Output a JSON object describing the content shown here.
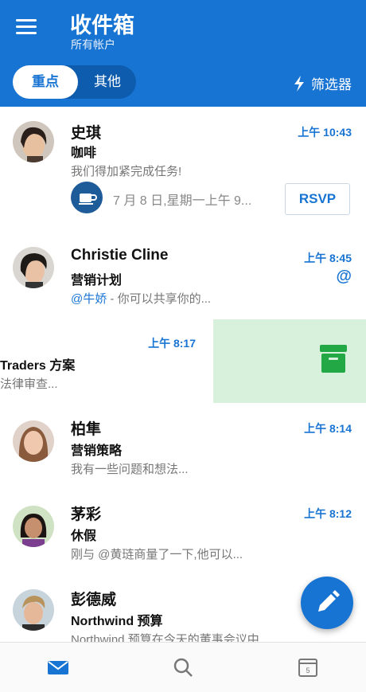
{
  "header": {
    "title": "收件箱",
    "subtitle": "所有帐户",
    "tabs": [
      {
        "label": "重点",
        "active": true
      },
      {
        "label": "其他",
        "active": false
      }
    ],
    "filter_label": "筛选器",
    "accent": "#1874d3"
  },
  "messages": [
    {
      "sender": "史琪",
      "subject": "咖啡",
      "preview": "我们得加紧完成任务!",
      "time": "上午 10:43",
      "event": {
        "text": "7 月 8 日,星期一上午 9...",
        "button": "RSVP"
      }
    },
    {
      "sender": "Christie Cline",
      "subject": "营销计划",
      "mention": "@牛娇",
      "preview": " - 你可以共享你的...",
      "time": "上午 8:45",
      "mention_icon": "@"
    },
    {
      "sender": "",
      "subject": "Traders 方案",
      "preview": "法律审查...",
      "time": "上午 8:17",
      "swiped": true,
      "action_icon": "archive-icon",
      "action_color": "#22a845"
    },
    {
      "sender": "柏隼",
      "subject": "营销策略",
      "preview": "我有一些问题和想法...",
      "time": "上午 8:14"
    },
    {
      "sender": "茅彩",
      "subject": "休假",
      "preview": "刚与 @黄琏商量了一下,他可以...",
      "time": "上午 8:12"
    },
    {
      "sender": "彭德威",
      "subject": "Northwind 预算",
      "preview": "Northwind 预算在今天的董事会议中",
      "time": ""
    }
  ],
  "tabbar": {
    "items": [
      "mail-icon",
      "search-icon",
      "calendar-icon"
    ],
    "calendar_day": "5"
  }
}
